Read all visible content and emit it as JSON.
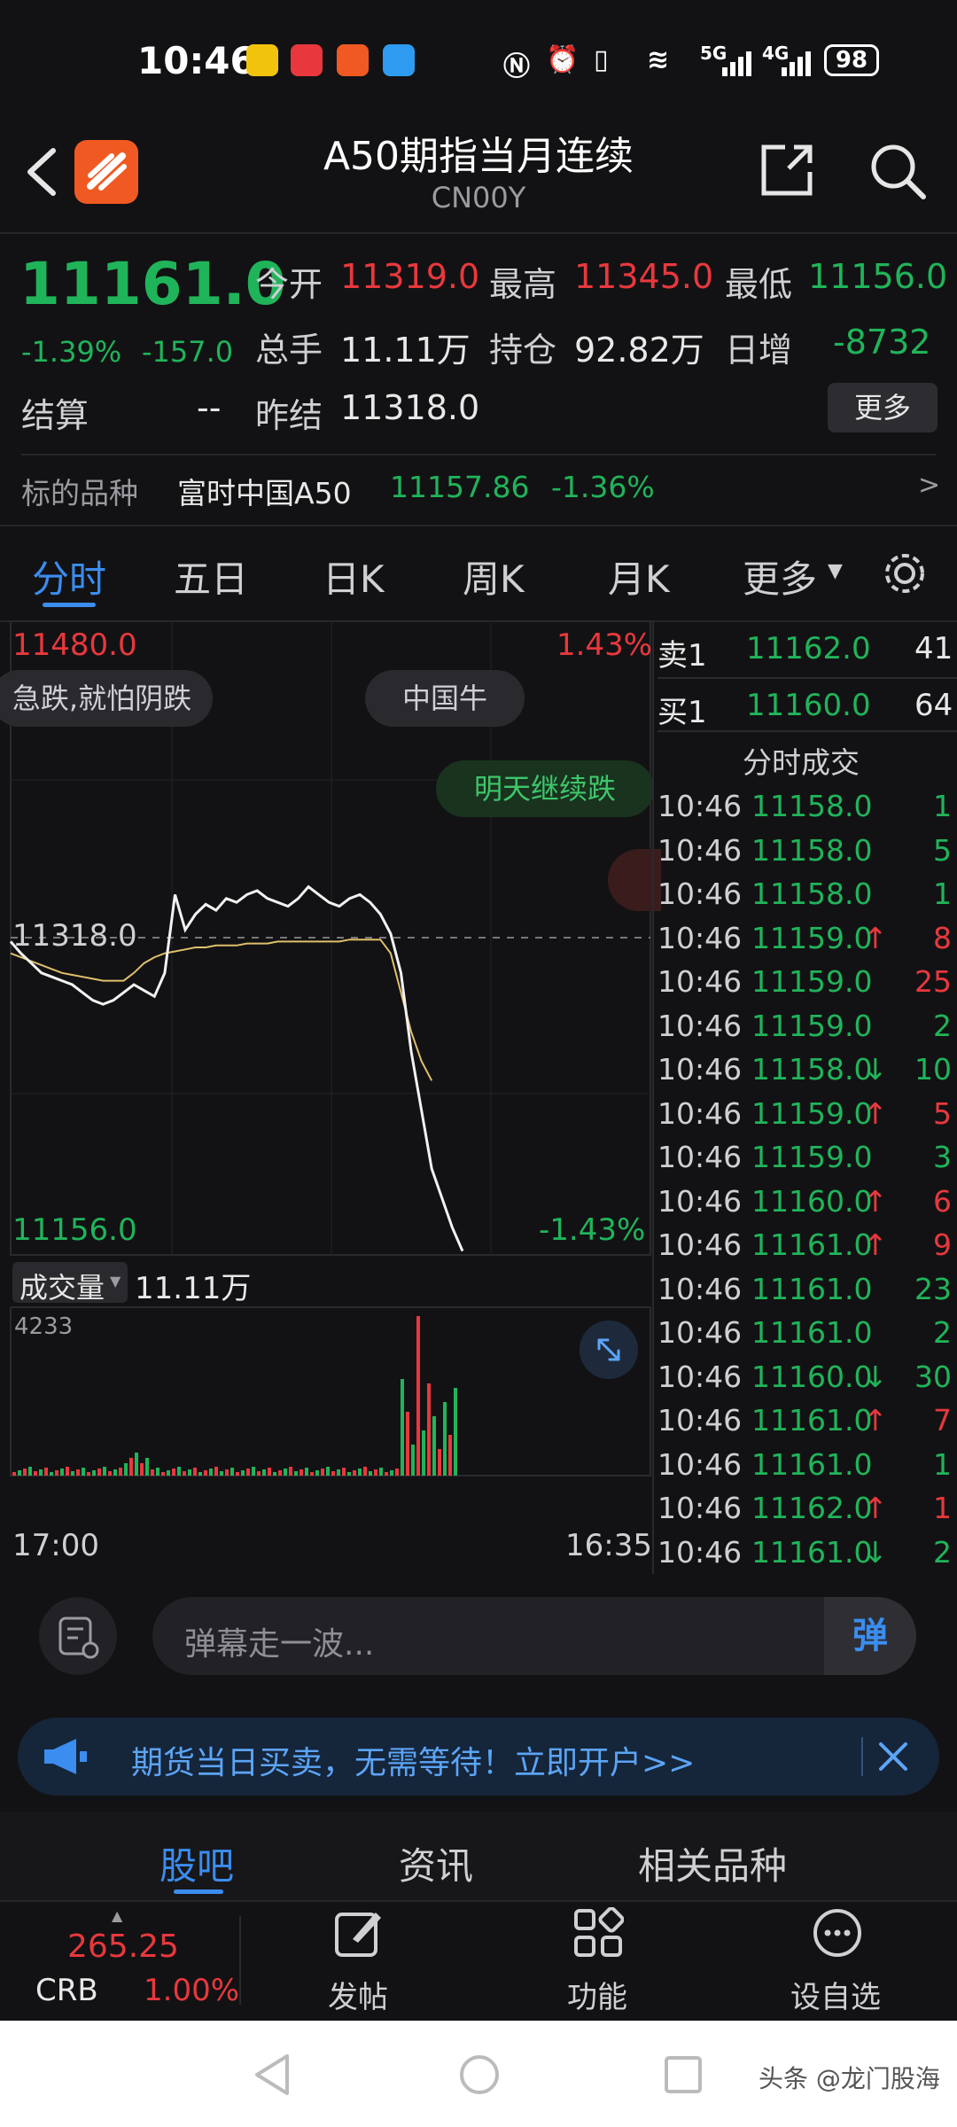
{
  "status_bar": {
    "time": "10:46",
    "network1": "5G",
    "network2": "4G",
    "battery": "98"
  },
  "header": {
    "title": "A50期指当月连续",
    "code": "CN00Y"
  },
  "quote": {
    "price": "11161.0",
    "change_pct": "-1.39%",
    "change": "-157.0",
    "open_label": "今开",
    "open": "11319.0",
    "high_label": "最高",
    "high": "11345.0",
    "low_label": "最低",
    "low": "11156.0",
    "volume_label": "总手",
    "volume": "11.11万",
    "oi_label": "持仓",
    "oi": "92.82万",
    "daily_inc_label": "日增",
    "daily_inc": "-8732",
    "settle_label": "结算",
    "settle": "--",
    "prev_settle_label": "昨结",
    "prev_settle": "11318.0",
    "more_button": "更多"
  },
  "underlying": {
    "label": "标的品种",
    "name": "富时中国A50",
    "price": "11157.86",
    "change_pct": "-1.36%",
    "arrow": ">"
  },
  "chart_tabs": [
    "分时",
    "五日",
    "日K",
    "周K",
    "月K",
    "更多"
  ],
  "chart": {
    "y_top": "11480.0",
    "y_mid": "11318.0",
    "y_bottom": "11156.0",
    "pct_top": "1.43%",
    "pct_bottom": "-1.43%",
    "danmaku": [
      "急跌,就怕阴跌",
      "中国牛",
      "明天继续跌"
    ],
    "volume_label": "成交量",
    "volume_value": "11.11万",
    "volume_max": "4233",
    "time_start": "17:00",
    "time_end": "16:35"
  },
  "chart_data": {
    "type": "line",
    "title": "",
    "xlabel": "",
    "ylabel": "",
    "ylim": [
      11156.0,
      11480.0
    ],
    "reference": 11318.0,
    "series": [
      {
        "values": [
          11316,
          11310,
          11305,
          11300,
          11298,
          11296,
          11294,
          11290,
          11286,
          11284,
          11286,
          11290,
          11294,
          11291,
          11288,
          11300,
          11340,
          11322,
          11330,
          11335,
          11332,
          11338,
          11336,
          11340,
          11342,
          11338,
          11336,
          11334,
          11338,
          11344,
          11340,
          11336,
          11334,
          11338,
          11340,
          11336,
          11330,
          11320,
          11300,
          11260,
          11230,
          11200,
          11185,
          11170,
          11158
        ]
      },
      {
        "values": [
          11310,
          11308,
          11306,
          11304,
          11302,
          11300,
          11299,
          11298,
          11297,
          11296,
          11296,
          11296,
          11300,
          11305,
          11308,
          11310,
          11311,
          11312,
          11313,
          11313,
          11314,
          11314,
          11314,
          11315,
          11315,
          11315,
          11316,
          11316,
          11316,
          11316,
          11316,
          11316,
          11316,
          11317,
          11317,
          11317,
          11317,
          11310,
          11290,
          11270,
          11255,
          11245
        ]
      }
    ]
  },
  "order_book": {
    "ask_label": "卖1",
    "ask_price": "11162.0",
    "ask_qty": "41",
    "bid_label": "买1",
    "bid_price": "11160.0",
    "bid_qty": "64",
    "ticks_title": "分时成交",
    "ticks": [
      {
        "time": "10:46",
        "price": "11158.0",
        "arrow": "",
        "qty": "1",
        "qty_color": "green"
      },
      {
        "time": "10:46",
        "price": "11158.0",
        "arrow": "",
        "qty": "5",
        "qty_color": "green"
      },
      {
        "time": "10:46",
        "price": "11158.0",
        "arrow": "",
        "qty": "1",
        "qty_color": "green"
      },
      {
        "time": "10:46",
        "price": "11159.0",
        "arrow": "↑",
        "qty": "8",
        "qty_color": "red"
      },
      {
        "time": "10:46",
        "price": "11159.0",
        "arrow": "",
        "qty": "25",
        "qty_color": "red"
      },
      {
        "time": "10:46",
        "price": "11159.0",
        "arrow": "",
        "qty": "2",
        "qty_color": "green"
      },
      {
        "time": "10:46",
        "price": "11158.0",
        "arrow": "↓",
        "qty": "10",
        "qty_color": "green"
      },
      {
        "time": "10:46",
        "price": "11159.0",
        "arrow": "↑",
        "qty": "5",
        "qty_color": "red"
      },
      {
        "time": "10:46",
        "price": "11159.0",
        "arrow": "",
        "qty": "3",
        "qty_color": "green"
      },
      {
        "time": "10:46",
        "price": "11160.0",
        "arrow": "↑",
        "qty": "6",
        "qty_color": "red"
      },
      {
        "time": "10:46",
        "price": "11161.0",
        "arrow": "↑",
        "qty": "9",
        "qty_color": "red"
      },
      {
        "time": "10:46",
        "price": "11161.0",
        "arrow": "",
        "qty": "23",
        "qty_color": "green"
      },
      {
        "time": "10:46",
        "price": "11161.0",
        "arrow": "",
        "qty": "2",
        "qty_color": "green"
      },
      {
        "time": "10:46",
        "price": "11160.0",
        "arrow": "↓",
        "qty": "30",
        "qty_color": "green"
      },
      {
        "time": "10:46",
        "price": "11161.0",
        "arrow": "↑",
        "qty": "7",
        "qty_color": "red"
      },
      {
        "time": "10:46",
        "price": "11161.0",
        "arrow": "",
        "qty": "1",
        "qty_color": "green"
      },
      {
        "time": "10:46",
        "price": "11162.0",
        "arrow": "↑",
        "qty": "1",
        "qty_color": "red"
      },
      {
        "time": "10:46",
        "price": "11161.0",
        "arrow": "↓",
        "qty": "2",
        "qty_color": "green"
      }
    ]
  },
  "danmaku_bar": {
    "placeholder": "弹幕走一波...",
    "send_label": "弹"
  },
  "banner": {
    "text": "期货当日买卖，无需等待！立即开户>>"
  },
  "section_tabs": [
    "股吧",
    "资讯",
    "相关品种"
  ],
  "bottom_toolbar": {
    "crb_value": "265.25",
    "crb_label": "CRB",
    "crb_pct": "1.00%",
    "post_label": "发帖",
    "function_label": "功能",
    "watchlist_label": "设自选"
  },
  "watermark": "头条 @龙门股海",
  "colors": {
    "up": "#e8383d",
    "down": "#20b45a",
    "accent": "#3b8df0",
    "background": "#121214"
  }
}
